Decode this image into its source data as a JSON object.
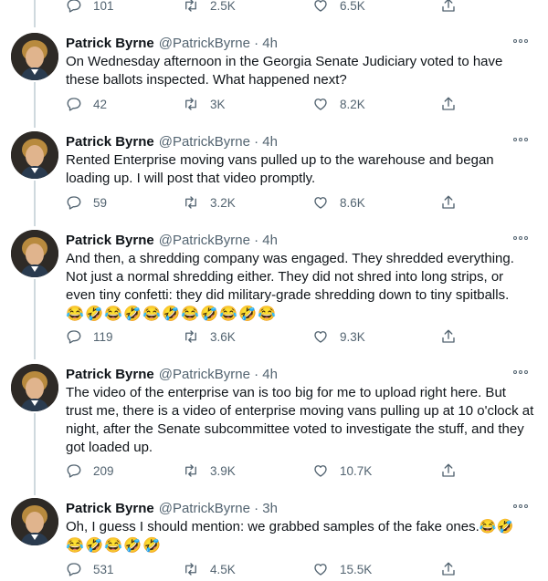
{
  "colors": {
    "text": "#0f1419",
    "secondary": "#536471",
    "thread": "#cfd9de",
    "bg": "#ffffff"
  },
  "top_actions": {
    "replies": "101",
    "retweets": "2.5K",
    "likes": "6.5K"
  },
  "tweets": [
    {
      "name": "Patrick Byrne",
      "handle": "@PatrickByrne · 4h",
      "text": "On Wednesday afternoon in the Georgia Senate Judiciary voted to have these ballots inspected. What happened next?",
      "replies": "42",
      "retweets": "3K",
      "likes": "8.2K"
    },
    {
      "name": "Patrick Byrne",
      "handle": "@PatrickByrne · 4h",
      "text": "Rented Enterprise moving vans pulled up to the warehouse and began loading up. I will post that video promptly.",
      "replies": "59",
      "retweets": "3.2K",
      "likes": "8.6K"
    },
    {
      "name": "Patrick Byrne",
      "handle": "@PatrickByrne · 4h",
      "text": "And then, a shredding company was engaged. They shredded everything. Not just a normal shredding either. They did not shred into long strips, or even tiny confetti: they did military-grade shredding down to tiny spitballs.",
      "emojis": [
        "😂",
        "🤣",
        "😂",
        "🤣",
        "😂",
        "🤣",
        "😂",
        "🤣",
        "😂",
        "🤣",
        "😂"
      ],
      "replies": "119",
      "retweets": "3.6K",
      "likes": "9.3K"
    },
    {
      "name": "Patrick Byrne",
      "handle": "@PatrickByrne · 4h",
      "text": "The video of the enterprise van is too big for me to upload right here. But trust me, there is a video of enterprise moving vans pulling up at 10 o'clock at night, after the Senate subcommittee voted to investigate the stuff, and they got loaded up.",
      "replies": "209",
      "retweets": "3.9K",
      "likes": "10.7K"
    },
    {
      "name": "Patrick Byrne",
      "handle": "@PatrickByrne · 3h",
      "text": "Oh, I guess I should mention: we grabbed samples of the fake ones.",
      "inline_emojis": "😂🤣",
      "emojis": [
        "😂",
        "🤣",
        "😂",
        "🤣",
        "🤣"
      ],
      "replies": "531",
      "retweets": "4.5K",
      "likes": "15.5K"
    }
  ]
}
